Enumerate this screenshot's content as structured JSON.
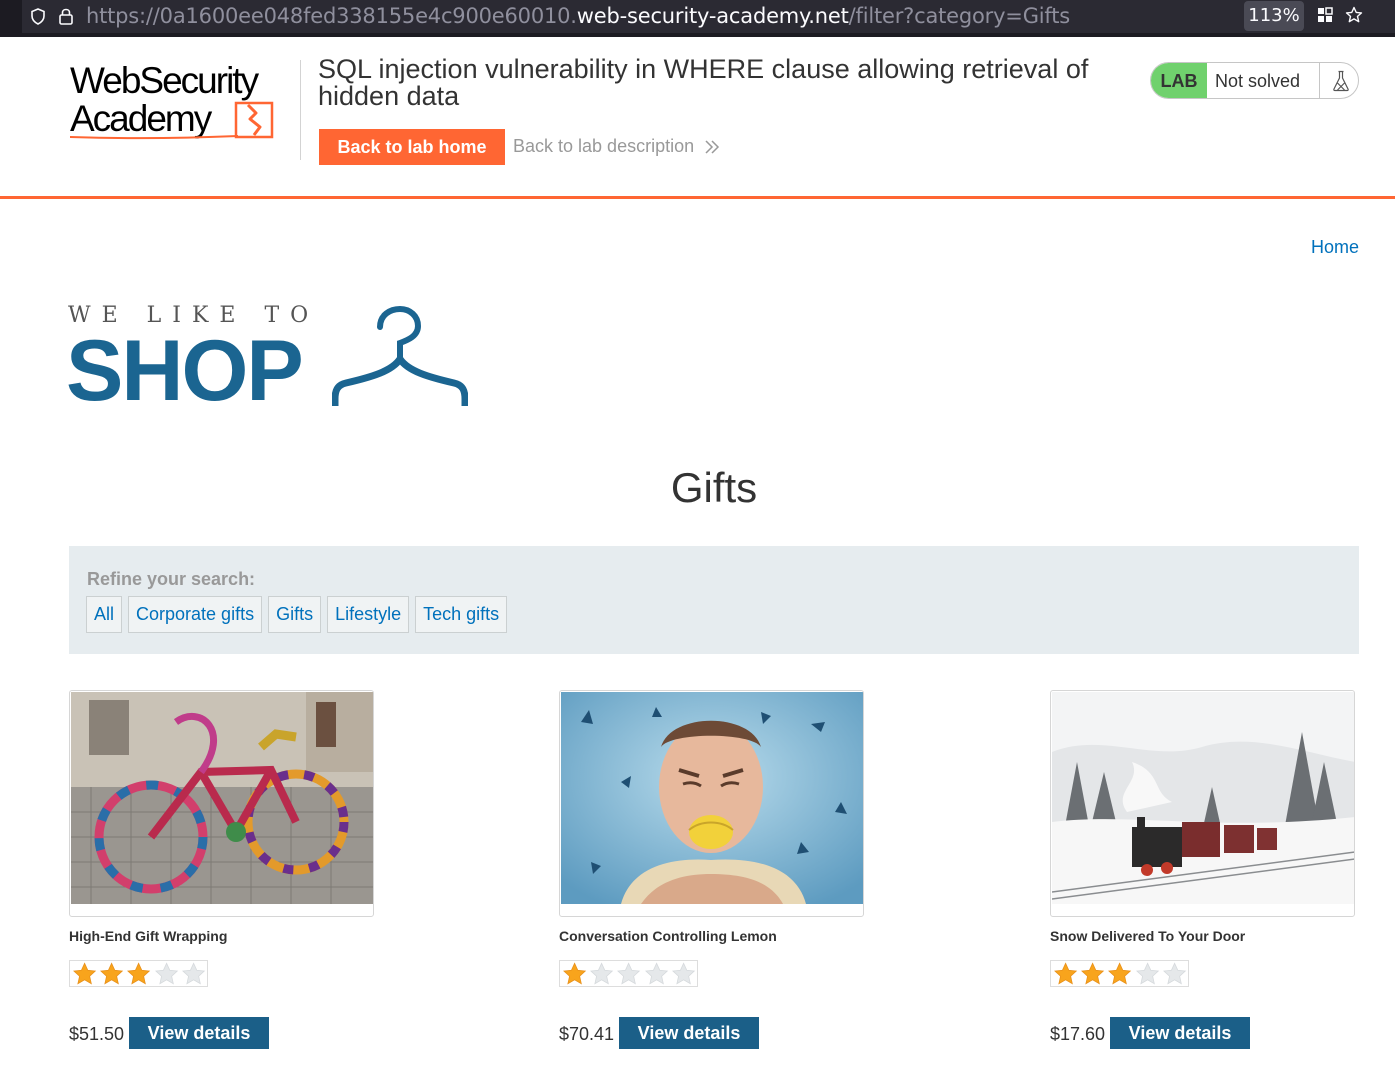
{
  "browser": {
    "url_prefix": "https://0a1600ee048fed338155e4c900e60010.",
    "url_domain": "web-security-academy.net",
    "url_path": "/filter?category=Gifts",
    "zoom": "113%"
  },
  "academy": {
    "logo_line1": "WebSecurity",
    "logo_line2": "Academy",
    "lab_title": "SQL injection vulnerability in WHERE clause allowing retrieval of hidden data",
    "back_home_label": "Back to lab home",
    "back_description_label": "Back to lab description",
    "lab_badge": "LAB",
    "lab_status": "Not solved",
    "accent_color": "#ff6633",
    "status_color": "#70d16d"
  },
  "shop": {
    "nav_home": "Home",
    "logo_tagline": "WE LIKE TO",
    "logo_word": "SHOP",
    "page_title": "Gifts",
    "filter_label": "Refine your search:",
    "filters": [
      "All",
      "Corporate gifts",
      "Gifts",
      "Lifestyle",
      "Tech gifts"
    ],
    "view_details_label": "View details",
    "products": [
      {
        "name": "High-End Gift Wrapping",
        "rating": 3,
        "price": "$51.50",
        "image": "yarn-bombed-bicycle"
      },
      {
        "name": "Conversation Controlling Lemon",
        "rating": 1,
        "price": "$70.41",
        "image": "man-biting-lemon"
      },
      {
        "name": "Snow Delivered To Your Door",
        "rating": 3,
        "price": "$17.60",
        "image": "steam-train-in-snow"
      }
    ]
  }
}
